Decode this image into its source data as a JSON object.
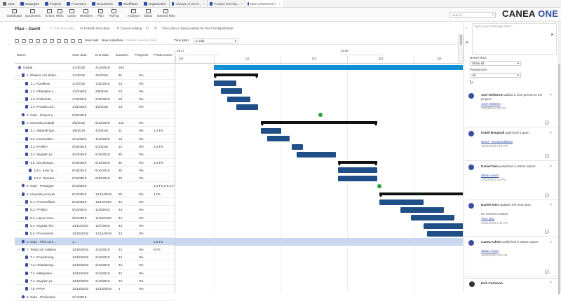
{
  "tabs": [
    {
      "label": "Start"
    },
    {
      "label": "Strategies"
    },
    {
      "label": "Projects"
    },
    {
      "label": "Processes"
    },
    {
      "label": "Documents"
    },
    {
      "label": "Workflows"
    },
    {
      "label": "Organization"
    }
  ],
  "doc_tabs": [
    {
      "label": "Change of purch..."
    },
    {
      "label": "Product develop..."
    },
    {
      "label": "New component f..."
    }
  ],
  "toolbar": [
    {
      "label": "Dashboard"
    },
    {
      "label": "Documents"
    },
    {
      "label": "To-Dos"
    },
    {
      "label": "Risks"
    },
    {
      "label": "Cases"
    },
    {
      "label": "Members"
    },
    {
      "label": "Plan"
    },
    {
      "label": "Roll-up"
    },
    {
      "label": "Analyses"
    },
    {
      "label": "Status"
    },
    {
      "label": "External links"
    }
  ],
  "search": {
    "placeholder": "search..."
  },
  "brand": {
    "a": "CANEA",
    "b": "ONE"
  },
  "page": {
    "title": "Plan - Gantt",
    "edit_plan": "Edit time plan",
    "publish": "Publish time plan",
    "cancel": "Cancel editing",
    "editing_note": "Time plan is being edited by Per-Olof Björkhede"
  },
  "gantt_toolbar": {
    "new_task": "New task",
    "new_milestone": "New milestone",
    "delete": "Delete selected task",
    "time_plan_label": "Time plan:",
    "time_plan_value": "In edit"
  },
  "columns": {
    "name": "Name",
    "start": "Start date",
    "end": "End date",
    "duration": "Duration",
    "progress": "Progress",
    "pred": "Predecessor"
  },
  "timeline": {
    "y2017": "2017",
    "y2018": "2018",
    "q2017": "Q4",
    "q1": "Q1",
    "q2": "Q2",
    "q3": "Q3",
    "q4": "Q4"
  },
  "rows": [
    {
      "name": "Global",
      "start": "1/1/2018",
      "end": "2/13/2019",
      "dur": "293",
      "prog": "",
      "pred": ""
    },
    {
      "name": "1. Plasera och defini...",
      "start": "1/1/2018",
      "end": "3/2/2018",
      "dur": "45",
      "prog": "0%",
      "pred": ""
    },
    {
      "name": "1.1. Kundkrav",
      "start": "1/1/2018",
      "end": "1/31/2018",
      "dur": "23",
      "prog": "0%",
      "pred": ""
    },
    {
      "name": "1.2. Affärsplan o...",
      "start": "1/10/2018",
      "end": "2/8/2018",
      "dur": "23",
      "prog": "0%",
      "pred": ""
    },
    {
      "name": "1.3. Preliminär ...",
      "start": "1/19/2018",
      "end": "2/19/2018",
      "dur": "23",
      "prog": "0%",
      "pred": ""
    },
    {
      "name": "1.4. Produkt och...",
      "start": "1/31/2018",
      "end": "3/2/2018",
      "dur": "23",
      "prog": "0%",
      "pred": ""
    },
    {
      "name": "2. Gate - Project a...",
      "start": "5/25/2018",
      "end": "",
      "dur": "",
      "prog": "",
      "pred": ""
    },
    {
      "name": "3. Utveckla produkt",
      "start": "3/5/2018",
      "end": "8/10/2018",
      "dur": "115",
      "prog": "0%",
      "pred": ""
    },
    {
      "name": "3.1. Materiel spe...",
      "start": "3/5/2018",
      "end": "4/2/2018",
      "dur": "21",
      "prog": "0%",
      "pred": "1.4.FS"
    },
    {
      "name": "3.2. Konstruktio...",
      "start": "3/14/2018",
      "end": "4/13/2018",
      "dur": "23",
      "prog": "0%",
      "pred": ""
    },
    {
      "name": "3.3. KFMEA",
      "start": "4/16/2018",
      "end": "5/1/2018",
      "dur": "12",
      "prog": "0%",
      "pred": "3.2.FS"
    },
    {
      "name": "3.4. Styrplan pr...",
      "start": "4/23/2018",
      "end": "6/15/2018",
      "dur": "40",
      "prog": "0%",
      "pred": ""
    },
    {
      "name": "3.5. Utrustnings...",
      "start": "6/18/2018",
      "end": "8/10/2018",
      "dur": "40",
      "prog": "0%",
      "pred": "3.4.FS"
    },
    {
      "name": "3.5.1. Krav ny ...",
      "start": "6/18/2018",
      "end": "8/10/2018",
      "dur": "40",
      "prog": "0%",
      "pred": ""
    },
    {
      "name": "3.5.2. Testutru...",
      "start": "6/18/2018",
      "end": "8/10/2018",
      "dur": "40",
      "prog": "0%",
      "pred": ""
    },
    {
      "name": "4. Gate - Prototype",
      "start": "8/13/2018",
      "end": "",
      "dur": "",
      "prog": "",
      "pred": "3.4.FS,3.5.2.FS"
    },
    {
      "name": "5. Utveckla process",
      "start": "8/13/2018",
      "end": "12/14/2018",
      "dur": "90",
      "prog": "0%",
      "pred": "4.FS"
    },
    {
      "name": "5.1. Processflöde",
      "start": "8/13/2018",
      "end": "10/11/2018",
      "dur": "44",
      "prog": "0%",
      "pred": ""
    },
    {
      "name": "5.2. PFMEA",
      "start": "9/10/2018",
      "end": "11/8/2018",
      "dur": "44",
      "prog": "0%",
      "pred": ""
    },
    {
      "name": "5.3. Layout över...",
      "start": "9/24/2018",
      "end": "11/22/2018",
      "dur": "44",
      "prog": "0%",
      "pred": ""
    },
    {
      "name": "5.4. Styrplan för...",
      "start": "10/11/2018",
      "end": "12/7/2018",
      "dur": "44",
      "prog": "0%",
      "pred": ""
    },
    {
      "name": "5.5. Processinst...",
      "start": "10/16/2018",
      "end": "12/14/2018",
      "dur": "44",
      "prog": "0%",
      "pred": ""
    },
    {
      "name": "6. Gate - Pilot com...",
      "start": "1...",
      "end": "",
      "dur": "",
      "prog": "",
      "pred": "5.5.FS"
    },
    {
      "name": "7. Testa och validera",
      "start": "12/18/2018",
      "end": "2/13/2019",
      "dur": "42",
      "prog": "0%",
      "pred": "6.FS"
    },
    {
      "name": "7.1. Provkörning ...",
      "start": "12/18/2018",
      "end": "2/13/2019",
      "dur": "42",
      "prog": "0%",
      "pred": ""
    },
    {
      "name": "7.2. Utvärdering...",
      "start": "12/18/2018",
      "end": "2/13/2019",
      "dur": "42",
      "prog": "0%",
      "pred": ""
    },
    {
      "name": "7.3. Mätsystem...",
      "start": "12/18/2018",
      "end": "2/13/2019",
      "dur": "42",
      "prog": "0%",
      "pred": ""
    },
    {
      "name": "7.4. Styrplan pr...",
      "start": "12/18/2018",
      "end": "2/13/2019",
      "dur": "42",
      "prog": "0%",
      "pred": ""
    },
    {
      "name": "7.5. PPAP",
      "start": "12/18/2018",
      "end": "12/18/2018",
      "dur": "1",
      "prog": "0%",
      "pred": ""
    },
    {
      "name": "8. Gate - Production",
      "start": "2/14/2019",
      "end": "",
      "dur": "",
      "prog": "",
      "pred": ""
    }
  ],
  "feed": {
    "message_placeholder": "Type your message here...",
    "newer_than_label": "Newer than:",
    "newer_than_value": "Show all",
    "perspective_label": "Perspective:",
    "perspective_value": "All",
    "items": [
      {
        "who": "Joel Hellström",
        "action": "added a new person to the project:",
        "sub": "Joel Hellström",
        "ts": "10/8/2018 1:51 PM"
      },
      {
        "who": "Patrik Bergwall",
        "action": "approved a gate:",
        "sub": "Grind - Serieproduktion",
        "ts": "12/21/2018 1:50 PM"
      },
      {
        "who": "Daniel Sten",
        "action": "published a status report:",
        "sub": "Status report",
        "ts": "11/5/2018 1:43 PM"
      },
      {
        "who": "Daniel Sten",
        "action": "updated the time plan:",
        "sub": "Time plan",
        "ts": "10/24/2018 1:43 PM",
        "extra": "No comment stated"
      },
      {
        "who": "Canea Admin",
        "action": "published a status report:",
        "sub": "Status report",
        "ts": "11/26/2018 1:59 PM"
      }
    ],
    "bottom_user": "Erik Carlsson"
  }
}
